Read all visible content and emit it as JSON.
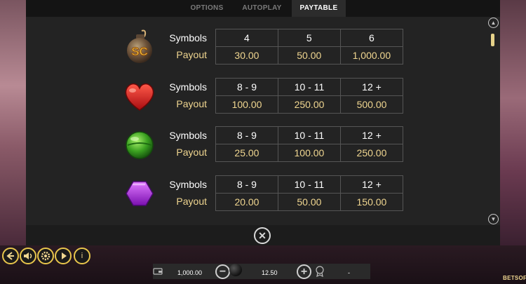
{
  "tabs": [
    {
      "label": "OPTIONS",
      "active": false
    },
    {
      "label": "AUTOPLAY",
      "active": false
    },
    {
      "label": "PAYTABLE",
      "active": true
    }
  ],
  "paytable": {
    "rows": [
      {
        "icon": "scatter-bomb-icon",
        "symbols_label": "Symbols",
        "payout_label": "Payout",
        "symbols": [
          "4",
          "5",
          "6"
        ],
        "payouts": [
          "30.00",
          "50.00",
          "1,000.00"
        ]
      },
      {
        "icon": "red-heart-candy-icon",
        "symbols_label": "Symbols",
        "payout_label": "Payout",
        "symbols": [
          "8 - 9",
          "10 - 11",
          "12 +"
        ],
        "payouts": [
          "100.00",
          "250.00",
          "500.00"
        ]
      },
      {
        "icon": "green-lollipop-candy-icon",
        "symbols_label": "Symbols",
        "payout_label": "Payout",
        "symbols": [
          "8 - 9",
          "10 - 11",
          "12 +"
        ],
        "payouts": [
          "25.00",
          "100.00",
          "250.00"
        ]
      },
      {
        "icon": "purple-hexagon-candy-icon",
        "symbols_label": "Symbols",
        "payout_label": "Payout",
        "symbols": [
          "8 - 9",
          "10 - 11",
          "12 +"
        ],
        "payouts": [
          "20.00",
          "50.00",
          "150.00"
        ]
      }
    ]
  },
  "scatter_badge": "SC",
  "controls": {
    "close_glyph": "✕",
    "scroll_up_glyph": "▲",
    "scroll_down_glyph": "▼",
    "info_glyph": "i",
    "minus_glyph": "−",
    "plus_glyph": "+"
  },
  "bottom_bar": {
    "balance": "1,000.00",
    "bet": "12.50",
    "win": "-"
  },
  "brand": "BETSOFT",
  "colors": {
    "accent_gold": "#f0d690",
    "control_ring": "#e8c64c",
    "panel_bg": "#232323"
  }
}
